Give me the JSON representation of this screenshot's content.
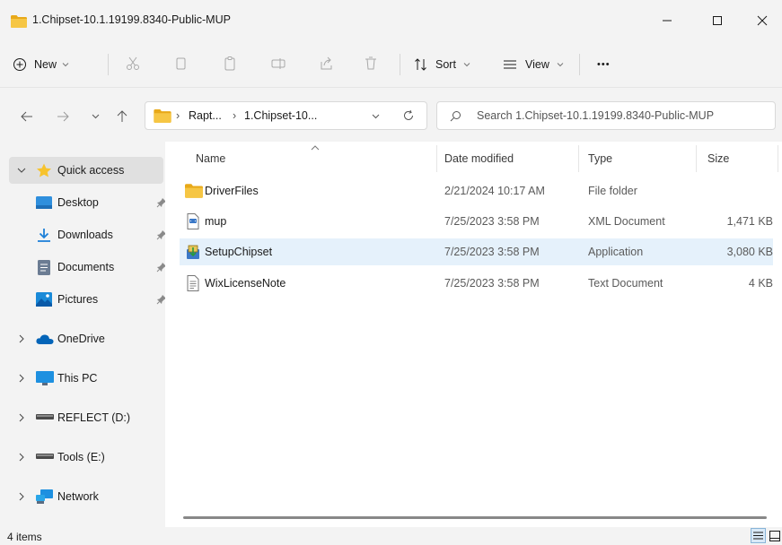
{
  "window": {
    "title": "1.Chipset-10.1.19199.8340-Public-MUP",
    "title_icon": "folder-icon"
  },
  "toolbar": {
    "new_label": "New",
    "sort_label": "Sort",
    "view_label": "View",
    "more_label": "•••"
  },
  "address": {
    "crumbs": [
      "Rapt...",
      "1.Chipset-10..."
    ],
    "search_placeholder": "Search 1.Chipset-10.1.19199.8340-Public-MUP"
  },
  "sidebar": {
    "items": [
      {
        "label": "Quick access",
        "icon": "star-icon",
        "expanded": true
      },
      {
        "label": "Desktop",
        "icon": "desktop-icon",
        "pinned": true
      },
      {
        "label": "Downloads",
        "icon": "download-icon",
        "pinned": true
      },
      {
        "label": "Documents",
        "icon": "documents-icon",
        "pinned": true
      },
      {
        "label": "Pictures",
        "icon": "pictures-icon",
        "pinned": true
      },
      {
        "label": "OneDrive",
        "icon": "cloud-icon"
      },
      {
        "label": "This PC",
        "icon": "monitor-icon"
      },
      {
        "label": "REFLECT (D:)",
        "icon": "drive-icon"
      },
      {
        "label": "Tools (E:)",
        "icon": "drive-icon"
      },
      {
        "label": "Network",
        "icon": "network-icon"
      }
    ]
  },
  "columns": {
    "name": "Name",
    "date": "Date modified",
    "type": "Type",
    "size": "Size"
  },
  "files": [
    {
      "name": "DriverFiles",
      "date": "2/21/2024 10:17 AM",
      "type": "File folder",
      "size": "",
      "icon": "folder-icon"
    },
    {
      "name": "mup",
      "date": "7/25/2023 3:58 PM",
      "type": "XML Document",
      "size": "1,471 KB",
      "icon": "xml-file-icon"
    },
    {
      "name": "SetupChipset",
      "date": "7/25/2023 3:58 PM",
      "type": "Application",
      "size": "3,080 KB",
      "icon": "installer-icon"
    },
    {
      "name": "WixLicenseNote",
      "date": "7/25/2023 3:58 PM",
      "type": "Text Document",
      "size": "4 KB",
      "icon": "text-file-icon"
    }
  ],
  "status": {
    "item_count": "4 items"
  },
  "colors": {
    "folder": "#f6c644",
    "accent": "#0067c0",
    "hover_row": "#e5f1fb"
  }
}
